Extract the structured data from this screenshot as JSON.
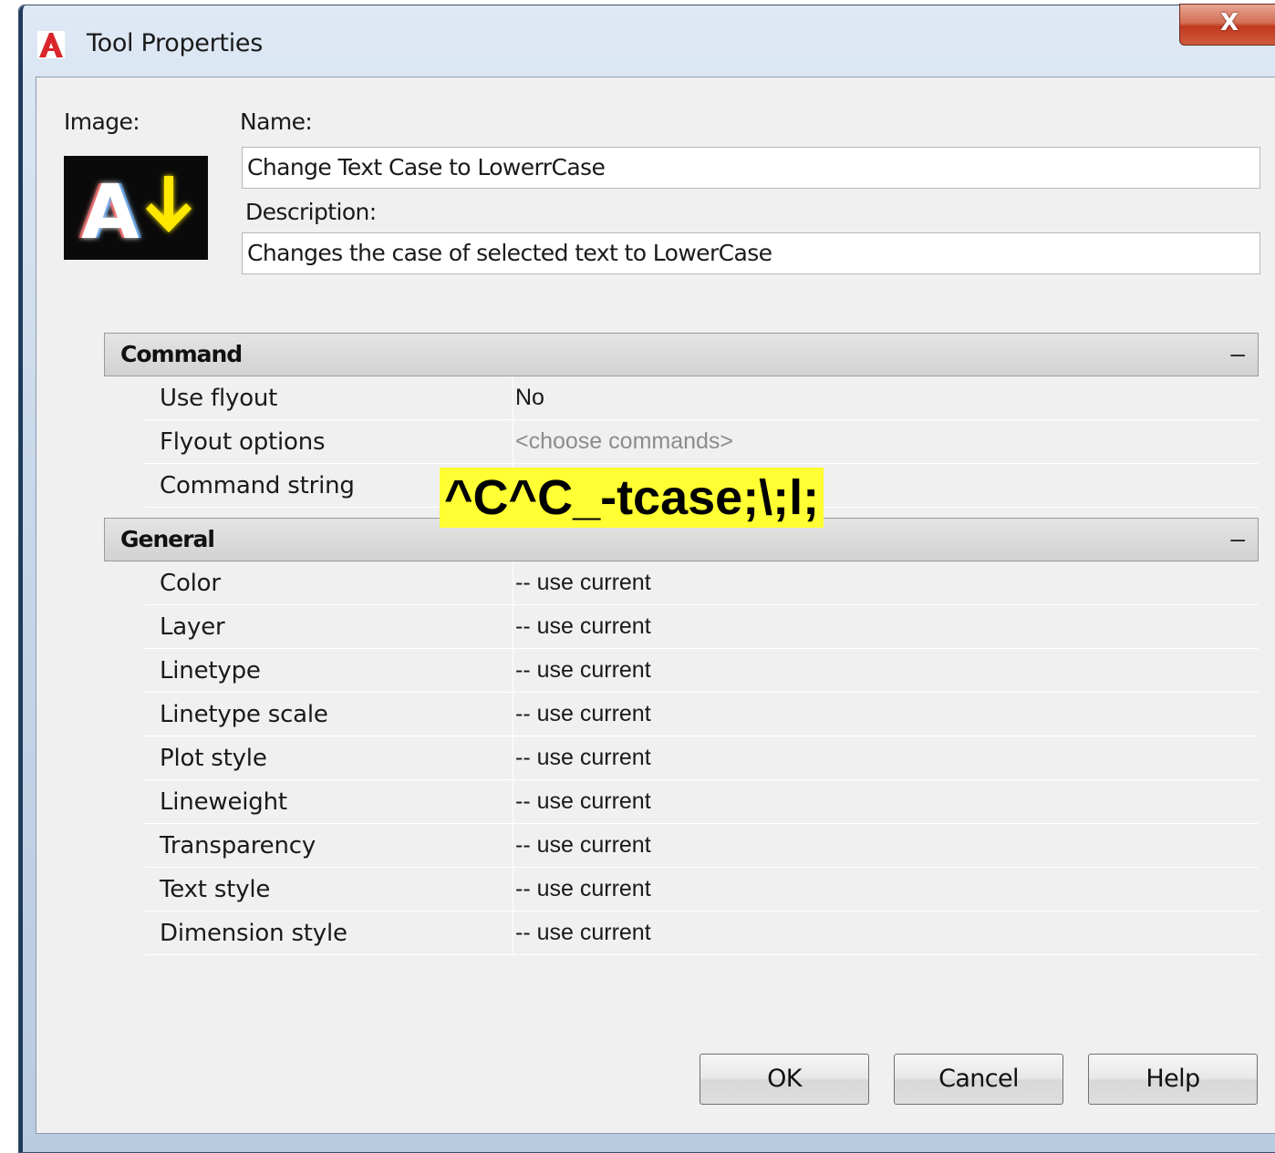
{
  "window": {
    "title": "Tool Properties",
    "close_label": "X"
  },
  "image_label": "Image:",
  "name": {
    "label": "Name:",
    "value": "Change Text Case to LowerrCase"
  },
  "description": {
    "label": "Description:",
    "value": "Changes the case of selected text to LowerCase"
  },
  "sections": {
    "command": {
      "title": "Command",
      "collapse": "–",
      "rows": [
        {
          "key": "Use flyout",
          "value": "No"
        },
        {
          "key": "Flyout options",
          "value": "<choose commands>"
        },
        {
          "key": "Command string",
          "value": ""
        }
      ]
    },
    "general": {
      "title": "General",
      "collapse": "–",
      "rows": [
        {
          "key": "Color",
          "value": " -- use current"
        },
        {
          "key": "Layer",
          "value": "-- use current"
        },
        {
          "key": "Linetype",
          "value": "-- use current"
        },
        {
          "key": "Linetype scale",
          "value": "-- use current"
        },
        {
          "key": "Plot style",
          "value": "-- use current"
        },
        {
          "key": "Lineweight",
          "value": "-- use current"
        },
        {
          "key": "Transparency",
          "value": "-- use current"
        },
        {
          "key": "Text style",
          "value": "-- use current"
        },
        {
          "key": "Dimension  style",
          "value": "-- use current"
        }
      ]
    }
  },
  "overlay_text": "^C^C_-tcase;\\;l;",
  "buttons": {
    "ok": "OK",
    "cancel": "Cancel",
    "help": "Help"
  },
  "colors": {
    "overlay_bg": "#ffff33",
    "close_red": "#c0391f",
    "app_icon_red": "#d8262c"
  }
}
